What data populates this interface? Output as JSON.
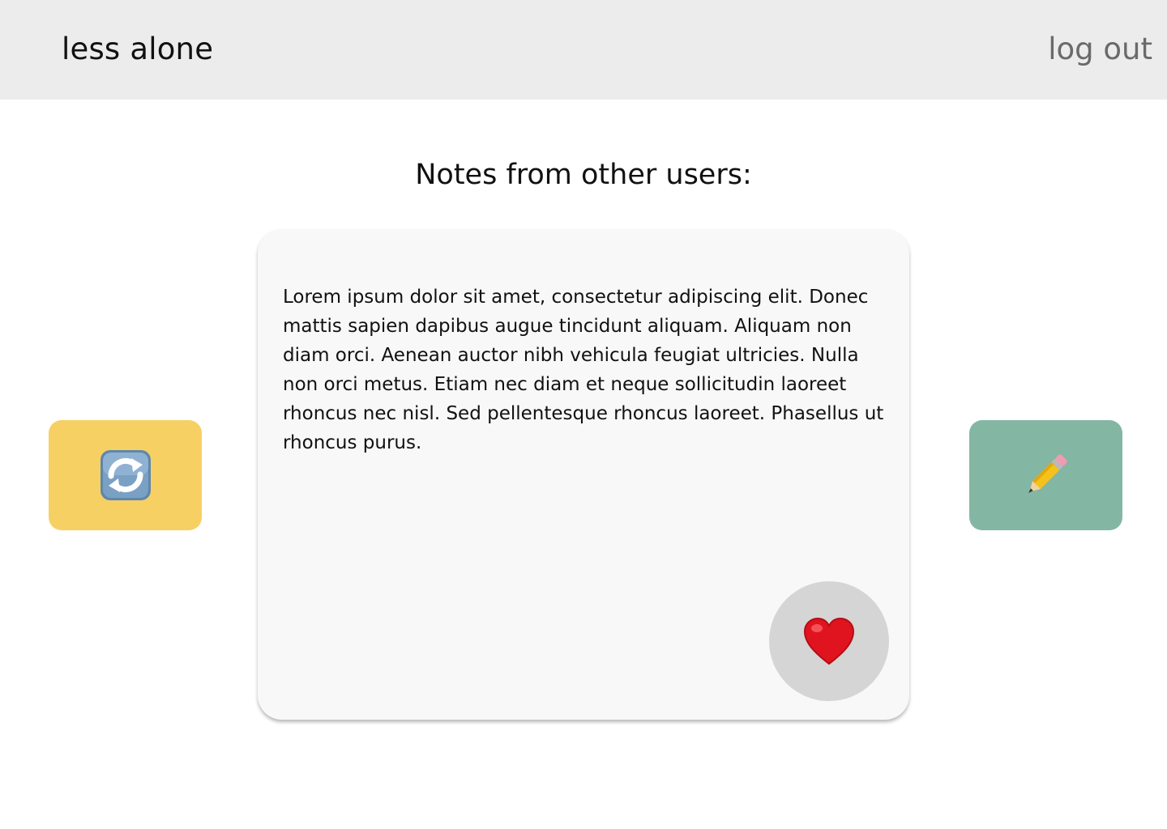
{
  "header": {
    "brand": "less alone",
    "logout_label": "log out"
  },
  "main": {
    "title": "Notes from other users:",
    "note": {
      "text": "Lorem ipsum dolor sit amet, consectetur adipiscing elit. Donec mattis sapien dapibus augue tincidunt aliquam. Aliquam non diam orci. Aenean auctor nibh vehicula feugiat ultricies. Nulla non orci metus. Etiam nec diam et neque sollicitudin laoreet rhoncus nec nisl. Sed pellentesque rhoncus laoreet. Phasellus ut rhoncus purus.",
      "like_icon": "heart-icon"
    },
    "refresh_button": {
      "icon": "refresh-icon",
      "color": "#f7d063"
    },
    "write_button": {
      "icon": "pencil-icon",
      "color": "#84b6a4"
    }
  },
  "colors": {
    "header_bg": "#ececec",
    "card_bg": "#f8f8f8",
    "like_bg": "#d5d5d5",
    "heart": "#e0141e"
  }
}
